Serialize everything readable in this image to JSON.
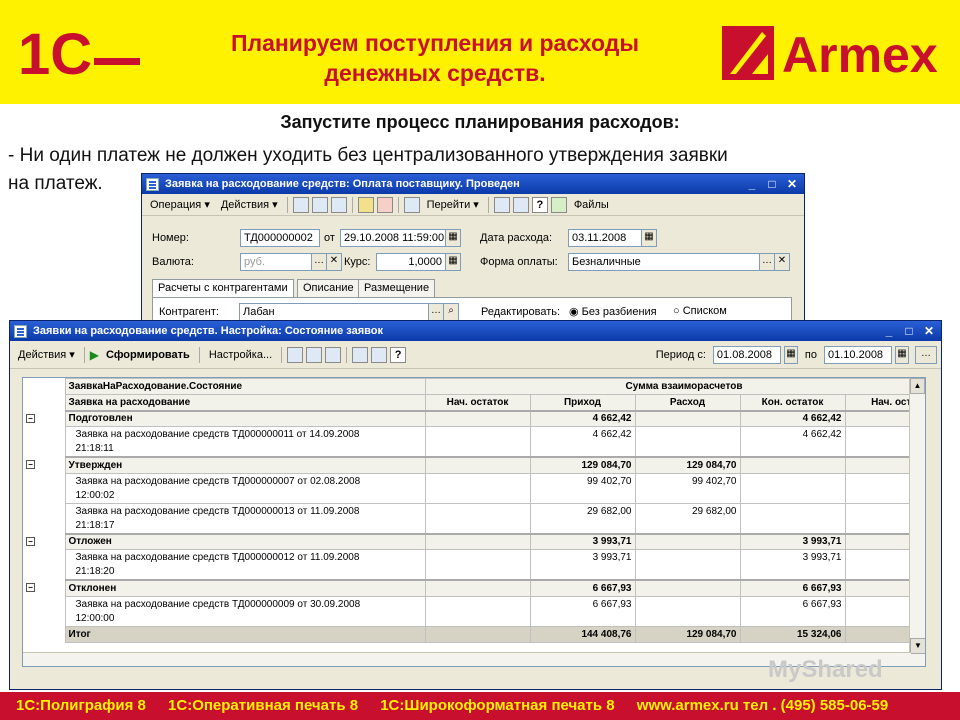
{
  "header": {
    "title_line1": "Планируем поступления и расходы",
    "title_line2": "денежных средств.",
    "brand_right": "Armex",
    "brand_left": "1С"
  },
  "subtitle": "Запустите процесс планирования расходов:",
  "body_line1": "- Ни один платеж не должен уходить без централизованного утверждения заявки",
  "body_line2": "на платеж.",
  "window1": {
    "title": "Заявка на расходование средств: Оплата поставщику. Проведен",
    "toolbar": {
      "operation": "Операция ▾",
      "actions": "Действия ▾",
      "goto": "Перейти ▾",
      "files": "Файлы"
    },
    "number_label": "Номер:",
    "number_value": "ТД000000002",
    "from_label": "от",
    "date_value": "29.10.2008 11:59:00",
    "expense_date_label": "Дата расхода:",
    "expense_date_value": "03.11.2008",
    "currency_label": "Валюта:",
    "currency_value": "руб.",
    "rate_label": "Курс:",
    "rate_value": "1,0000",
    "payment_form_label": "Форма оплаты:",
    "payment_form_value": "Безналичные",
    "tabs": [
      "Расчеты с контрагентами",
      "Описание",
      "Размещение"
    ],
    "counterparty_label": "Контрагент:",
    "counterparty_value": "Лабан",
    "edit_label": "Редактировать:",
    "radio1": "Без разбиения",
    "radio2": "Списком"
  },
  "window2": {
    "title": "Заявки на расходование средств. Настройка: Состояние заявок",
    "toolbar": {
      "actions": "Действия ▾",
      "generate": "Сформировать",
      "settings": "Настройка..."
    },
    "period_from_label": "Период с:",
    "period_from": "01.08.2008",
    "period_to_label": "по",
    "period_to": "01.10.2008",
    "table": {
      "head1": "ЗаявкаНаРасходование.Состояние",
      "head1_group": "Сумма взаиморасчетов",
      "head2": "Заявка на расходование",
      "columns": [
        "Нач. остаток",
        "Приход",
        "Расход",
        "Кон. остаток",
        "Нач. оста"
      ],
      "groups": [
        {
          "name": "Подготовлен",
          "income": "4 662,42",
          "expense": "",
          "end": "4 662,42",
          "rows": [
            {
              "line1": "Заявка на расходование средств ТД000000011 от 14.09.2008",
              "line2": "21:18:11",
              "income": "4 662,42",
              "expense": "",
              "end": "4 662,42"
            }
          ]
        },
        {
          "name": "Утвержден",
          "income": "129 084,70",
          "expense": "129 084,70",
          "end": "",
          "rows": [
            {
              "line1": "Заявка на расходование средств ТД000000007 от 02.08.2008",
              "line2": "12:00:02",
              "income": "99 402,70",
              "expense": "99 402,70",
              "end": ""
            },
            {
              "line1": "Заявка на расходование средств ТД000000013 от 11.09.2008",
              "line2": "21:18:17",
              "income": "29 682,00",
              "expense": "29 682,00",
              "end": ""
            }
          ]
        },
        {
          "name": "Отложен",
          "income": "3 993,71",
          "expense": "",
          "end": "3 993,71",
          "rows": [
            {
              "line1": "Заявка на расходование средств ТД000000012 от 11.09.2008",
              "line2": "21:18:20",
              "income": "3 993,71",
              "expense": "",
              "end": "3 993,71"
            }
          ]
        },
        {
          "name": "Отклонен",
          "income": "6 667,93",
          "expense": "",
          "end": "6 667,93",
          "rows": [
            {
              "line1": "Заявка на расходование средств ТД000000009 от 30.09.2008",
              "line2": "12:00:00",
              "income": "6 667,93",
              "expense": "",
              "end": "6 667,93"
            }
          ]
        }
      ],
      "total": {
        "name": "Итог",
        "income": "144 408,76",
        "expense": "129 084,70",
        "end": "15 324,06"
      }
    }
  },
  "footer": [
    "1С:Полиграфия 8",
    "1С:Оперативная печать 8",
    "1С:Широкоформатная печать 8",
    "www.armex.ru тел . (495) 585-06-59"
  ],
  "watermark": "MyShared"
}
